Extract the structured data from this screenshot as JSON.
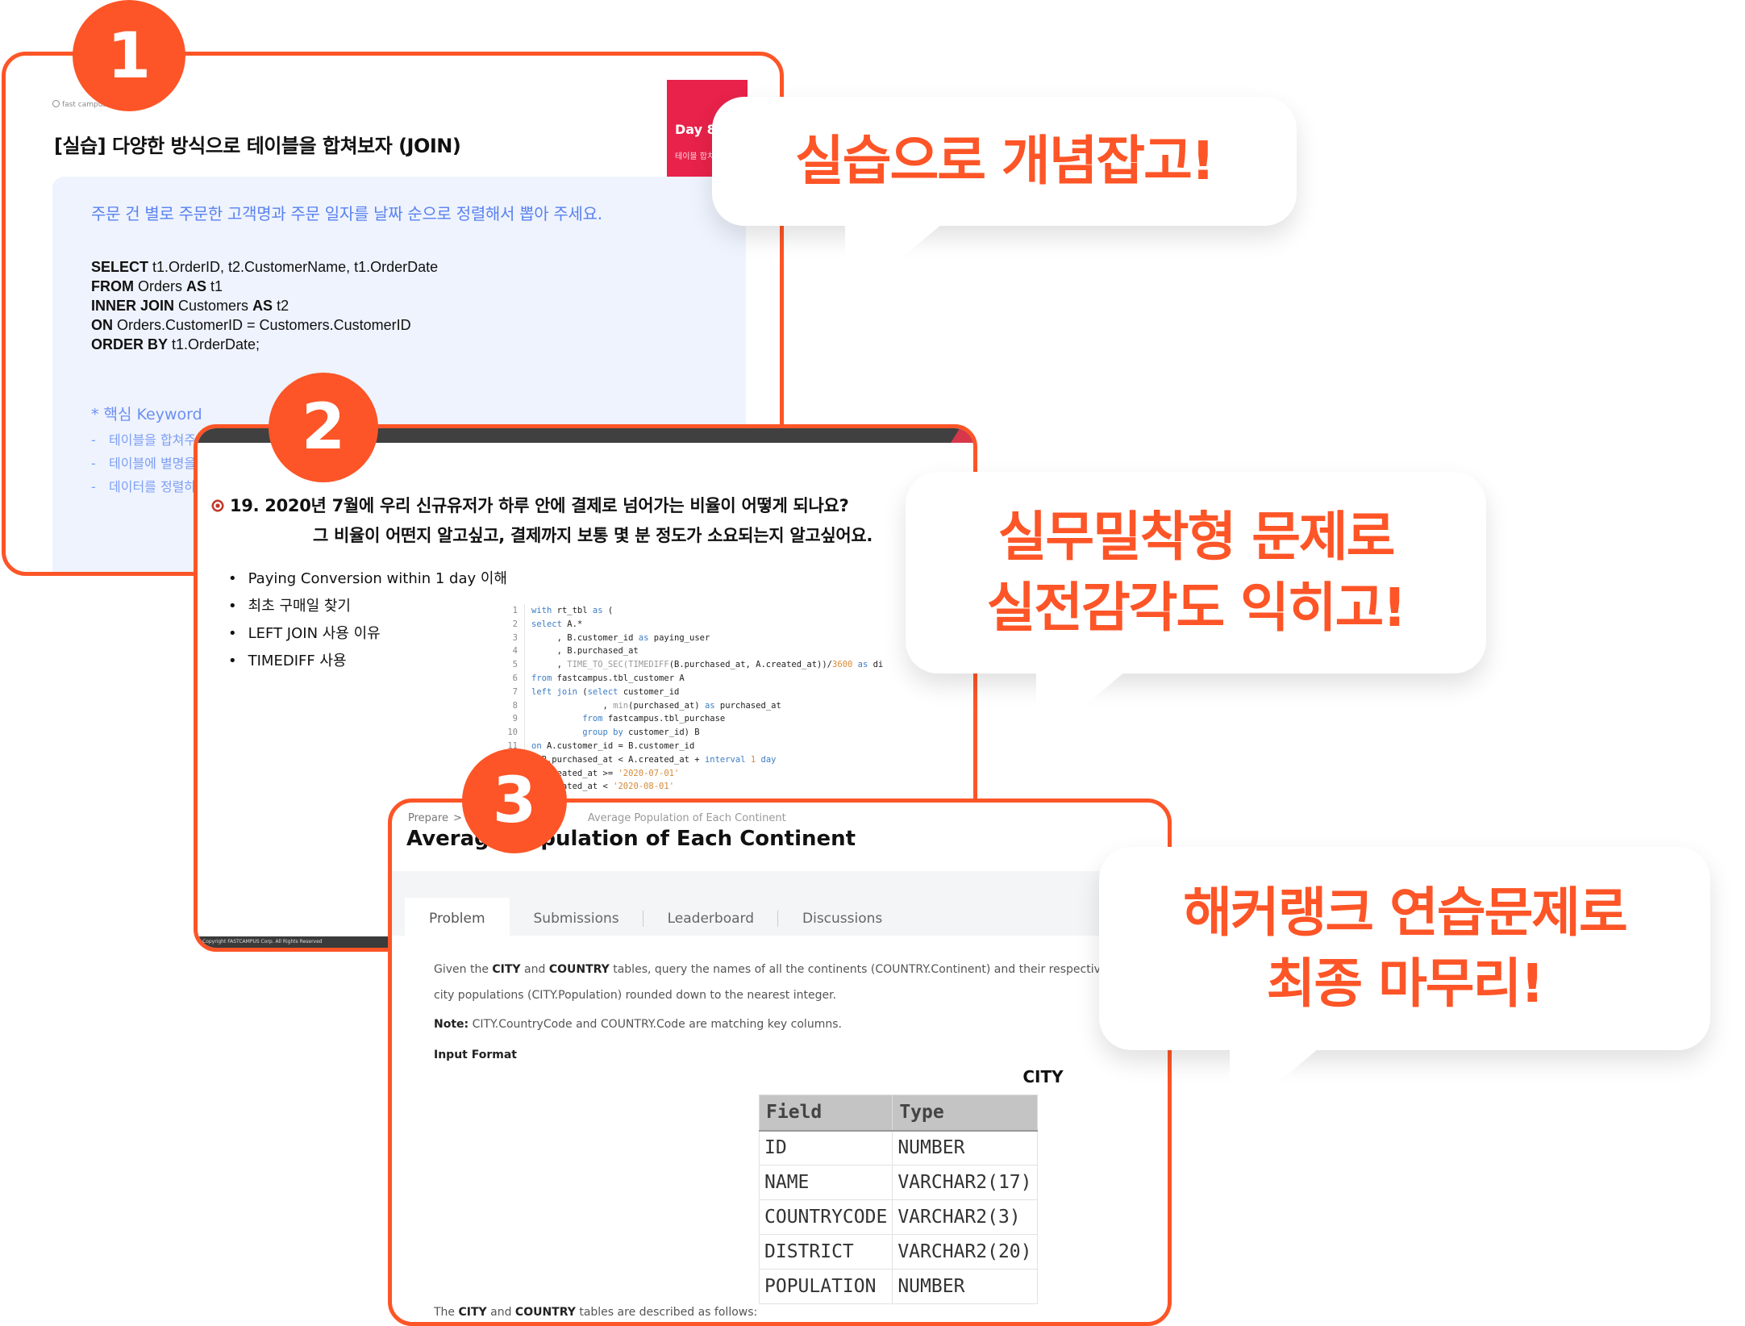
{
  "colors": {
    "accent": "#fd5527",
    "day_band": "#e8224a",
    "question_blue": "#5a82f0",
    "panel_bg": "#eef3fd"
  },
  "badges": [
    "1",
    "2",
    "3"
  ],
  "card1": {
    "brand": "fast campus",
    "title": "[실습] 다양한 방식으로 테이블을 합쳐보자 (JOIN)",
    "day_label": "Day 8.",
    "day_sub": "테이블 합치",
    "question": "주문 건 별로 주문한 고객명과 주문 일자를 날짜 순으로 정렬해서 뽑아 주세요.",
    "sql": [
      {
        "kw": "SELECT",
        "rest": " t1.OrderID, t2.CustomerName, t1.OrderDate"
      },
      {
        "kw": "FROM",
        "rest": " Orders ",
        "kw2": "AS",
        "rest2": " t1"
      },
      {
        "kw": "INNER JOIN",
        "rest": " Customers ",
        "kw2": "AS",
        "rest2": " t2"
      },
      {
        "kw": "ON",
        "rest": " Orders.CustomerID  = Customers.CustomerID"
      },
      {
        "kw": "ORDER BY",
        "rest": " t1.OrderDate;"
      }
    ],
    "keyword_title": "* 핵심 Keyword",
    "keywords": [
      "테이블을 합쳐주",
      "테이블에 별명을",
      "데이터를 정렬하"
    ]
  },
  "card2": {
    "question_line1": "19.  2020년 7월에 우리 신규유저가 하루 안에 결제로 넘어가는 비율이 어떻게 되나요?",
    "question_line2": "그 비율이 어떤지 알고싶고, 결제까지 보통 몇 분 정도가 소요되는지 알고싶어요.",
    "bullets": [
      "Paying Conversion within 1 day 이해",
      "최초 구매일 찾기",
      "LEFT JOIN 사용 이유",
      "TIMEDIFF 사용"
    ],
    "code_lines": [
      {
        "n": "1",
        "parts": [
          [
            "k",
            "with"
          ],
          [
            "t",
            " rt_tbl "
          ],
          [
            "k",
            "as"
          ],
          [
            "t",
            " ("
          ]
        ]
      },
      {
        "n": "2",
        "parts": [
          [
            "k",
            "select"
          ],
          [
            "t",
            " A.*"
          ]
        ]
      },
      {
        "n": "3",
        "parts": [
          [
            "t",
            "     , B.customer_id "
          ],
          [
            "k",
            "as"
          ],
          [
            "t",
            " paying_user"
          ]
        ]
      },
      {
        "n": "4",
        "parts": [
          [
            "t",
            "     , B.purchased_at"
          ]
        ]
      },
      {
        "n": "5",
        "parts": [
          [
            "t",
            "     , "
          ],
          [
            "f",
            "TIME_TO_SEC("
          ],
          [
            "f",
            "TIMEDIFF"
          ],
          [
            "t",
            "(B.purchased_at, A.created_at))/"
          ],
          [
            "s",
            "3600"
          ],
          [
            "t",
            " "
          ],
          [
            "k",
            "as"
          ],
          [
            "t",
            " di"
          ]
        ]
      },
      {
        "n": "6",
        "parts": [
          [
            "k",
            "from"
          ],
          [
            "t",
            " fastcampus.tbl_customer A"
          ]
        ]
      },
      {
        "n": "7",
        "parts": [
          [
            "k",
            "left join"
          ],
          [
            "t",
            " ("
          ],
          [
            "k",
            "select"
          ],
          [
            "t",
            " customer_id"
          ]
        ]
      },
      {
        "n": "8",
        "parts": [
          [
            "t",
            "              , "
          ],
          [
            "f",
            "min"
          ],
          [
            "t",
            "(purchased_at) "
          ],
          [
            "k",
            "as"
          ],
          [
            "t",
            " purchased_at"
          ]
        ]
      },
      {
        "n": "9",
        "parts": [
          [
            "t",
            "          "
          ],
          [
            "k",
            "from"
          ],
          [
            "t",
            " fastcampus.tbl_purchase"
          ]
        ]
      },
      {
        "n": "10",
        "parts": [
          [
            "t",
            "          "
          ],
          [
            "k",
            "group by"
          ],
          [
            "t",
            " customer_id) B"
          ]
        ]
      },
      {
        "n": "11",
        "parts": [
          [
            "k",
            "on"
          ],
          [
            "t",
            " A.customer_id = B.customer_id"
          ]
        ]
      },
      {
        "n": "12",
        "parts": [
          [
            "t",
            "  B.purchased_at < A.created_at + "
          ],
          [
            "k",
            "interval"
          ],
          [
            "t",
            " "
          ],
          [
            "s",
            "1"
          ],
          [
            "t",
            " "
          ],
          [
            "k",
            "day"
          ]
        ]
      },
      {
        "n": "",
        "parts": [
          [
            "t",
            ""
          ]
        ]
      },
      {
        "n": "",
        "parts": [
          [
            "t",
            "  .created_at >= "
          ],
          [
            "s",
            "'2020-07-01'"
          ]
        ]
      },
      {
        "n": "",
        "parts": [
          [
            "t",
            "  .created_at < "
          ],
          [
            "s",
            "'2020-08-01'"
          ]
        ]
      }
    ],
    "footer": "Copyright FASTCAMPUS Corp. All Rights Reserved"
  },
  "card3": {
    "breadcrumb": {
      "root": "Prepare",
      "separator": ">",
      "current": "Average Population of Each Continent"
    },
    "title": "Average Population of Each Continent",
    "tabs": [
      {
        "label": "Problem",
        "active": true
      },
      {
        "label": "Submissions",
        "active": false
      },
      {
        "label": "Leaderboard",
        "active": false
      },
      {
        "label": "Discussions",
        "active": false
      }
    ],
    "p1_pre": "Given the ",
    "p1_b1": "CITY",
    "p1_mid": " and ",
    "p1_b2": "COUNTRY",
    "p1_post": " tables, query the names of all the continents (COUNTRY.Continent) and their respective ave",
    "p2": "city populations (CITY.Population) rounded down to the nearest integer.",
    "note_label": "Note:",
    "note_text": " CITY.CountryCode and COUNTRY.Code are matching key columns.",
    "input_format": "Input Format",
    "table_caption": "CITY",
    "table_headers": [
      "Field",
      "Type"
    ],
    "table_rows": [
      [
        "ID",
        "NUMBER"
      ],
      [
        "NAME",
        "VARCHAR2(17)"
      ],
      [
        "COUNTRYCODE",
        "VARCHAR2(3)"
      ],
      [
        "DISTRICT",
        "VARCHAR2(20)"
      ],
      [
        "POPULATION",
        "NUMBER"
      ]
    ],
    "desc_pre": "The ",
    "desc_b1": "CITY",
    "desc_mid": " and ",
    "desc_b2": "COUNTRY",
    "desc_post": " tables are described as follows:"
  },
  "bubbles": [
    {
      "lines": [
        "실습으로 개념잡고!"
      ]
    },
    {
      "lines": [
        "실무밀착형 문제로",
        "실전감각도 익히고!"
      ]
    },
    {
      "lines": [
        "해커랭크 연습문제로",
        "최종 마무리!"
      ]
    }
  ]
}
